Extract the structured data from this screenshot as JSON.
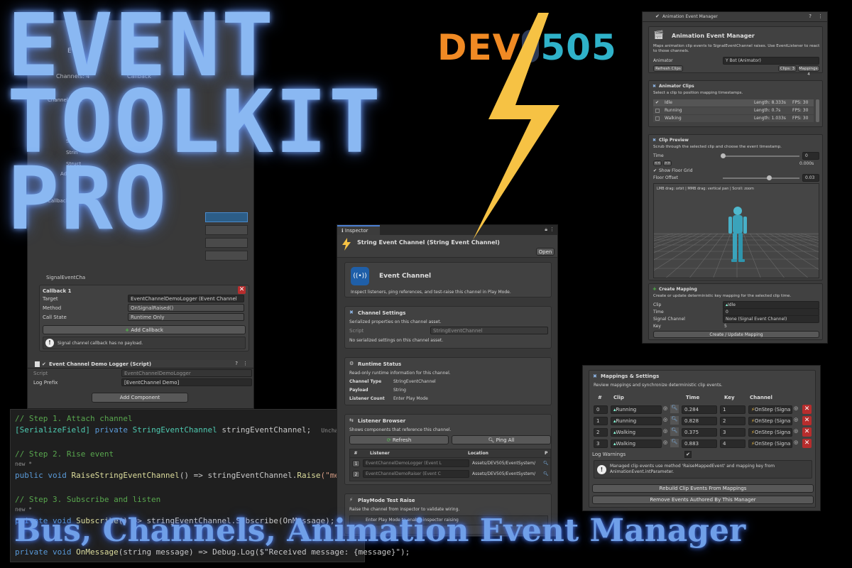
{
  "headline": {
    "line1": "EVENT",
    "line2": "TOOLKIT",
    "line3": "PRO"
  },
  "subtitle": "Bus, Channels, Animation Event Manager",
  "logo": {
    "dev": "DEV",
    "num": "505"
  },
  "colors": {
    "accent_blue": "#8ab8f2",
    "logo_orange": "#f08a24",
    "logo_teal": "#2fb2c9",
    "bolt": "#f6c244",
    "delete_red": "#b72d2d"
  },
  "left_panel": {
    "partial_top": [
      "istc",
      "Eve",
      "Channels: 4",
      "Callback",
      "Channel Table",
      "Strin",
      "Strin",
      "Struct",
      "Add Chan",
      "Callback Tabs",
      "SignalEventCha"
    ],
    "callback_title": "Callback 1",
    "target_label": "Target",
    "target_value": "EventChannelDemoLogger (Event Channel",
    "method_label": "Method",
    "method_value": "OnSignalRaised()",
    "callstate_label": "Call State",
    "callstate_value": "Runtime Only",
    "add_callback": "Add Callback",
    "info": "Signal channel callback has no payload.",
    "component_title": "Event Channel Demo Logger (Script)",
    "script_label": "Script",
    "script_value": "EventChannelDemoLogger",
    "prefix_label": "Log Prefix",
    "prefix_value": "[EventChannel Demo]",
    "add_component": "Add Component"
  },
  "code": {
    "l1": "// Step 1. Attach channel",
    "l2_attr": "[SerializeField]",
    "l2_rest": " private ",
    "l2_type": "StringEventChannel",
    "l2_name": " stringEventChannel;",
    "l2_note": "Unchanged",
    "l3": "// Step 2. Rise event",
    "l4": "new *",
    "l5_kw": "public void ",
    "l5_fn": "RaiseStringEventChannel",
    "l5_mid": "() => stringEventChannel.",
    "l5_fn2": "Raise",
    "l5_str": "(\"message\");",
    "l6": "// Step 3. Subscribe and listen",
    "l7": "new *",
    "l8_kw": "private void ",
    "l8_fn": "Subscribe",
    "l8_rest": "() => stringEventChannel.Subscribe(OnMessage);",
    "l9_kw": "private void ",
    "l9_fn": "OnMessage",
    "l9_rest": "(string message) => Debug.Log($\"Received message: {message}\");"
  },
  "inspector": {
    "tab": "Inspector",
    "title": "String Event Channel (String Event Channel)",
    "open": "Open",
    "header_title": "Event Channel",
    "header_desc": "Inspect listeners, ping references, and test-raise this channel in Play Mode.",
    "settings_title": "Channel Settings",
    "settings_desc": "Serialized properties on this channel asset.",
    "script_label": "Script",
    "script_value": "StringEventChannel",
    "no_settings": "No serialized settings on this channel asset.",
    "runtime_title": "Runtime Status",
    "runtime_desc": "Read-only runtime information for this channel.",
    "rt_rows": [
      {
        "k": "Channel Type",
        "v": "StringEventChannel"
      },
      {
        "k": "Payload",
        "v": "String"
      },
      {
        "k": "Listener Count",
        "v": "Enter Play Mode"
      }
    ],
    "browser_title": "Listener Browser",
    "browser_desc": "Shows components that reference this channel.",
    "refresh": "Refresh",
    "ping_all": "Ping All",
    "cols": {
      "num": "#",
      "listener": "Listener",
      "location": "Location",
      "p": "P"
    },
    "listeners": [
      {
        "n": "1",
        "name": "EventChannelDemoLogger (Event L",
        "loc": "Assets/DEV505/EventSystem/"
      },
      {
        "n": "2",
        "name": "EventChannelDemoRaiser (Event C",
        "loc": "Assets/DEV505/EventSystem/"
      }
    ],
    "playmode_title": "PlayMode Test Raise",
    "playmode_desc": "Raise the channel from inspector to validate wiring.",
    "playmode_info": "Enter Play Mode to enable inspector raising"
  },
  "anim": {
    "window": "Animation Event Manager",
    "title": "Animation Event Manager",
    "desc": "Maps animation clip events to SignalEventChannel raises. Use EventListener to react to those channels.",
    "animator_label": "Animator",
    "animator_value": "Y Bot (Animator)",
    "refresh": "Refresh Clips",
    "clips_badge": "Clips: 3",
    "mappings_badge": "Mappings: 4",
    "clips_title": "Animator Clips",
    "clips_desc": "Select a clip to position mapping timestamps.",
    "clips": [
      {
        "name": "Idle",
        "len": "Length: 8.333s",
        "fps": "FPS: 30"
      },
      {
        "name": "Running",
        "len": "Length: 0.7s",
        "fps": "FPS: 30"
      },
      {
        "name": "Walking",
        "len": "Length: 1.033s",
        "fps": "FPS: 30"
      }
    ],
    "preview_title": "Clip Preview",
    "preview_desc": "Scrub through the selected clip and choose the event timestamp.",
    "time_label": "Time",
    "time_value": "0",
    "time_readout": "0.000s",
    "prev": "<<",
    "next": ">>",
    "floor_grid": "Show Floor Grid",
    "floor_offset": "Floor Offset",
    "floor_value": "0.03",
    "viewport_hint": "LMB drag: orbit | MMB drag: vertical pan | Scroll: zoom",
    "time_fraction": 0.0,
    "floor_fraction": 0.6,
    "create_title": "Create Mapping",
    "create_desc": "Create or update deterministic key mapping for the selected clip time.",
    "clip_label": "Clip",
    "clip_value": "Idle",
    "ctime_label": "Time",
    "ctime_value": "0",
    "channel_label": "Signal Channel",
    "channel_value": "None (Signal Event Channel)",
    "key_label": "Key",
    "key_value": "5",
    "create_btn": "Create / Update Mapping"
  },
  "mappings": {
    "title": "Mappings & Settings",
    "desc": "Review mappings and synchronize deterministic clip events.",
    "cols": {
      "n": "#",
      "clip": "Clip",
      "time": "Time",
      "key": "Key",
      "channel": "Channel"
    },
    "rows": [
      {
        "n": "0",
        "clip": "Running",
        "time": "0.284",
        "key": "1",
        "channel": "OnStep (Signa"
      },
      {
        "n": "1",
        "clip": "Running",
        "time": "0.828",
        "key": "2",
        "channel": "OnStep (Signa"
      },
      {
        "n": "2",
        "clip": "Walking",
        "time": "0.375",
        "key": "3",
        "channel": "OnStep (Signa"
      },
      {
        "n": "3",
        "clip": "Walking",
        "time": "0.883",
        "key": "4",
        "channel": "OnStep (Signa"
      }
    ],
    "log_label": "Log Warnings",
    "info": "Managed clip events use method 'RaiseMappedEvent' and mapping key from AnimationEvent.intParameter.",
    "rebuild": "Rebuild Clip Events From Mappings",
    "remove": "Remove Events Authored By This Manager"
  }
}
